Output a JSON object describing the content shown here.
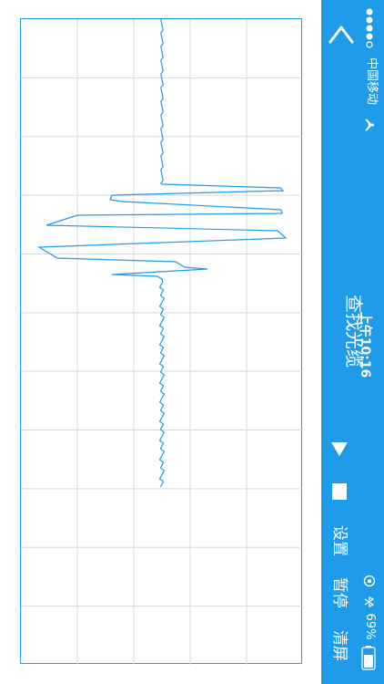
{
  "status": {
    "carrier": "中国移动",
    "time": "上午10:16",
    "battery": "69%"
  },
  "header": {
    "title": "查找光缆"
  },
  "controls": {
    "play_icon": "play-triangle-icon",
    "stop_icon": "stop-square-icon",
    "settings_label": "设置",
    "pause_label": "暂停",
    "clear_label": "清屏"
  },
  "icons": {
    "back": "chevron-left-icon",
    "signal": "signal-dots-icon",
    "wifi": "wifi-icon",
    "lock": "rotation-lock-icon",
    "bluetooth": "bluetooth-icon",
    "battery": "battery-icon"
  },
  "colors": {
    "accent": "#1e9be9",
    "grid": "#d9d9d9",
    "trace": "#1e9be9"
  }
}
